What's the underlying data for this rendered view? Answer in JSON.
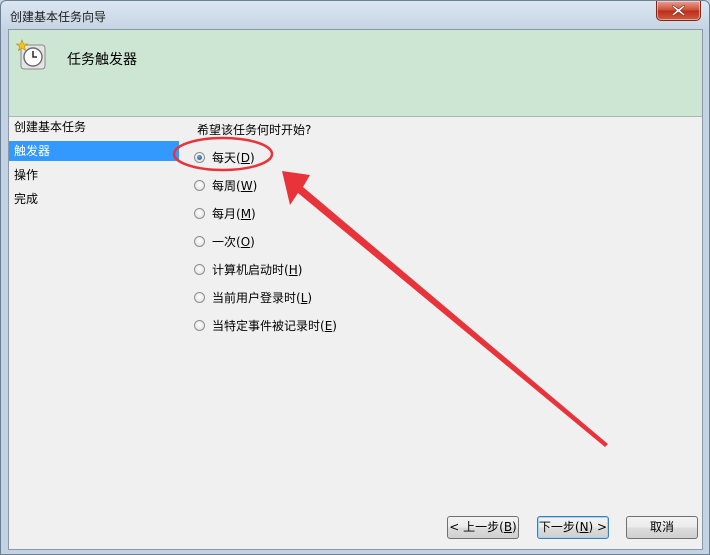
{
  "window": {
    "title": "创建基本任务向导"
  },
  "header": {
    "title": "任务触发器"
  },
  "sidebar": {
    "items": [
      {
        "label": "创建基本任务",
        "selected": false
      },
      {
        "label": "触发器",
        "selected": true
      },
      {
        "label": "操作",
        "selected": false
      },
      {
        "label": "完成",
        "selected": false
      }
    ]
  },
  "main": {
    "question": "希望该任务何时开始?",
    "options": [
      {
        "text": "每天(",
        "key": "D",
        "close": ")",
        "checked": true
      },
      {
        "text": "每周(",
        "key": "W",
        "close": ")",
        "checked": false
      },
      {
        "text": "每月(",
        "key": "M",
        "close": ")",
        "checked": false
      },
      {
        "text": "一次(",
        "key": "O",
        "close": ")",
        "checked": false
      },
      {
        "text": "计算机启动时(",
        "key": "H",
        "close": ")",
        "checked": false
      },
      {
        "text": "当前用户登录时(",
        "key": "L",
        "close": ")",
        "checked": false
      },
      {
        "text": "当特定事件被记录时(",
        "key": "E",
        "close": ")",
        "checked": false
      }
    ]
  },
  "buttons": {
    "back": {
      "text": "< 上一步(",
      "key": "B",
      "close": ")"
    },
    "next": {
      "text": "下一步(",
      "key": "N",
      "close": ") >"
    },
    "cancel": {
      "text": "取消"
    }
  },
  "colors": {
    "header_band": "#cde6d4",
    "selection": "#3399ff",
    "annotation": "#e8333a"
  }
}
